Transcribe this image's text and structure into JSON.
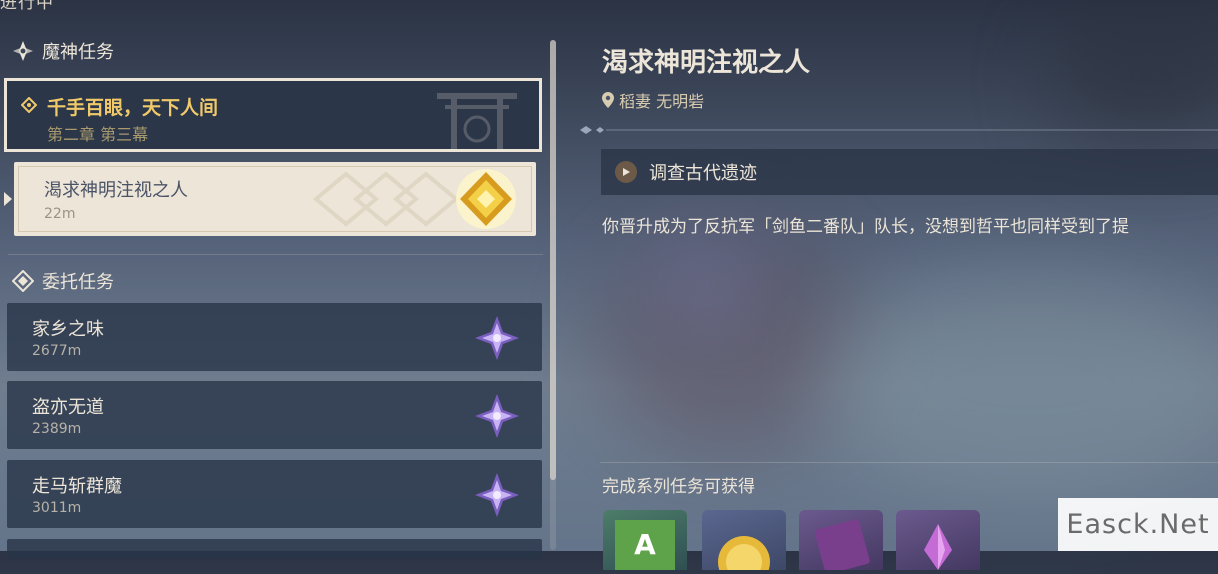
{
  "header": {
    "title": "进行中"
  },
  "sections": {
    "archon": {
      "label": "魔神任务"
    },
    "commission": {
      "label": "委托任务"
    }
  },
  "main_quest": {
    "title": "千手百眼，天下人间",
    "subtitle": "第二章 第三幕"
  },
  "selected_quest": {
    "title": "渴求神明注视之人",
    "distance": "22m"
  },
  "commissions": [
    {
      "title": "家乡之味",
      "distance": "2677m"
    },
    {
      "title": "盗亦无道",
      "distance": "2389m"
    },
    {
      "title": "走马斩群魔",
      "distance": "3011m"
    }
  ],
  "detail": {
    "title": "渴求神明注视之人",
    "location": "稻妻 无明砦",
    "objective": "调查古代遗迹",
    "description": "你晋升成为了反抗军「剑鱼二番队」队长，没想到哲平也同样受到了提",
    "reward_label": "完成系列任务可获得"
  },
  "watermark": "Easck.Net",
  "colors": {
    "accent_gold": "#f0c96b",
    "cream": "#ece5d8",
    "commission_purple": "#a78be0",
    "panel_dark": "#2c3649"
  },
  "icons": {
    "archon_section": "archon-quest-icon",
    "commission_section": "commission-quest-icon",
    "main_quest_marker": "quest-marker-icon",
    "selected_quest": "gold-diamond-quest-icon",
    "commission": "purple-star-commission-icon",
    "location": "location-pin-icon",
    "objective": "play-arrow-icon"
  }
}
